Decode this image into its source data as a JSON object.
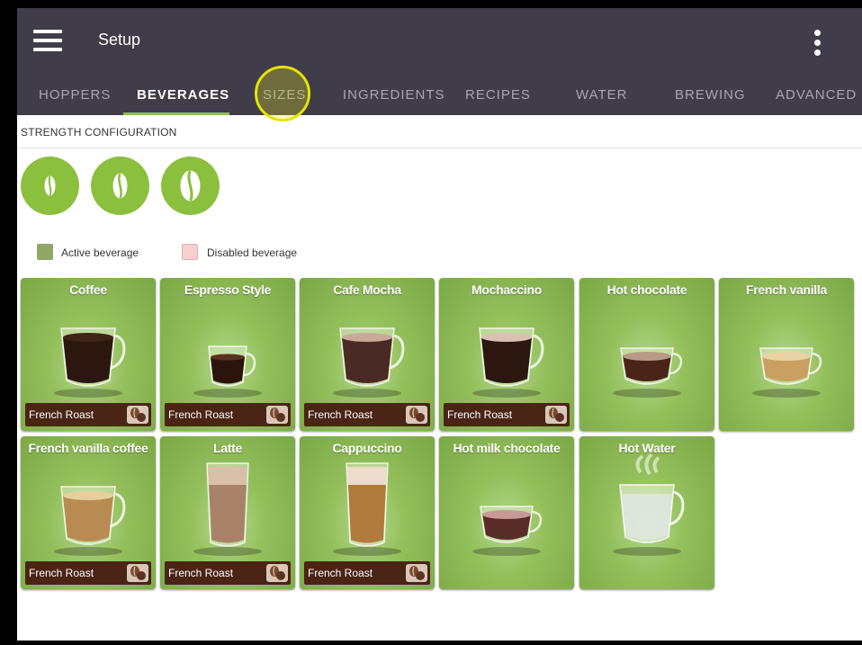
{
  "header": {
    "title": "Setup",
    "menu_icon": "hamburger-menu-icon",
    "overflow_icon": "more-vert-icon"
  },
  "tabs": [
    {
      "label": "HOPPERS",
      "active": false
    },
    {
      "label": "BEVERAGES",
      "active": true
    },
    {
      "label": "SIZES",
      "active": false
    },
    {
      "label": "INGREDIENTS",
      "active": false
    },
    {
      "label": "RECIPES",
      "active": false
    },
    {
      "label": "WATER",
      "active": false
    },
    {
      "label": "BREWING",
      "active": false
    },
    {
      "label": "ADVANCED",
      "active": false
    }
  ],
  "strength": {
    "label": "STRENGTH CONFIGURATION",
    "levels": [
      "bean-mild-icon",
      "bean-medium-icon",
      "bean-strong-icon"
    ]
  },
  "legend": {
    "active_label": "Active beverage",
    "disabled_label": "Disabled beverage",
    "active_color": "#8fa86a",
    "disabled_color": "#f6cfcf"
  },
  "beverages": [
    {
      "name": "Coffee",
      "roast": "French Roast",
      "cup": "mug",
      "liquid": "#2b1710",
      "foam": "#3e2518"
    },
    {
      "name": "Espresso Style",
      "roast": "French Roast",
      "cup": "small-mug",
      "liquid": "#2a140c",
      "foam": "#5a3320"
    },
    {
      "name": "Cafe Mocha",
      "roast": "French Roast",
      "cup": "mug",
      "liquid": "#4a2a24",
      "foam": "#c9aa98"
    },
    {
      "name": "Mochaccino",
      "roast": "French Roast",
      "cup": "mug",
      "liquid": "#2b1710",
      "foam": "#d8c0b2"
    },
    {
      "name": "Hot chocolate",
      "roast": "",
      "cup": "bowl",
      "liquid": "#4a2418",
      "foam": "#b89a86"
    },
    {
      "name": "French vanilla",
      "roast": "",
      "cup": "bowl",
      "liquid": "#c9a061",
      "foam": "#e9d4a6"
    },
    {
      "name": "French vanilla coffee",
      "roast": "French Roast",
      "cup": "mug",
      "liquid": "#b88b52",
      "foam": "#e7cf9d"
    },
    {
      "name": "Latte",
      "roast": "French Roast",
      "cup": "tall-glass",
      "liquid": "#a8836a",
      "foam": "#d9c0a8"
    },
    {
      "name": "Cappuccino",
      "roast": "French Roast",
      "cup": "tall-glass",
      "liquid": "#b07a3c",
      "foam": "#ecdccb"
    },
    {
      "name": "Hot milk chocolate",
      "roast": "",
      "cup": "bowl",
      "liquid": "#5a2c28",
      "foam": "#c79a98"
    },
    {
      "name": "Hot Water",
      "roast": "",
      "cup": "water-mug",
      "liquid": "#dfe6e2",
      "foam": "#eef2ef"
    }
  ]
}
